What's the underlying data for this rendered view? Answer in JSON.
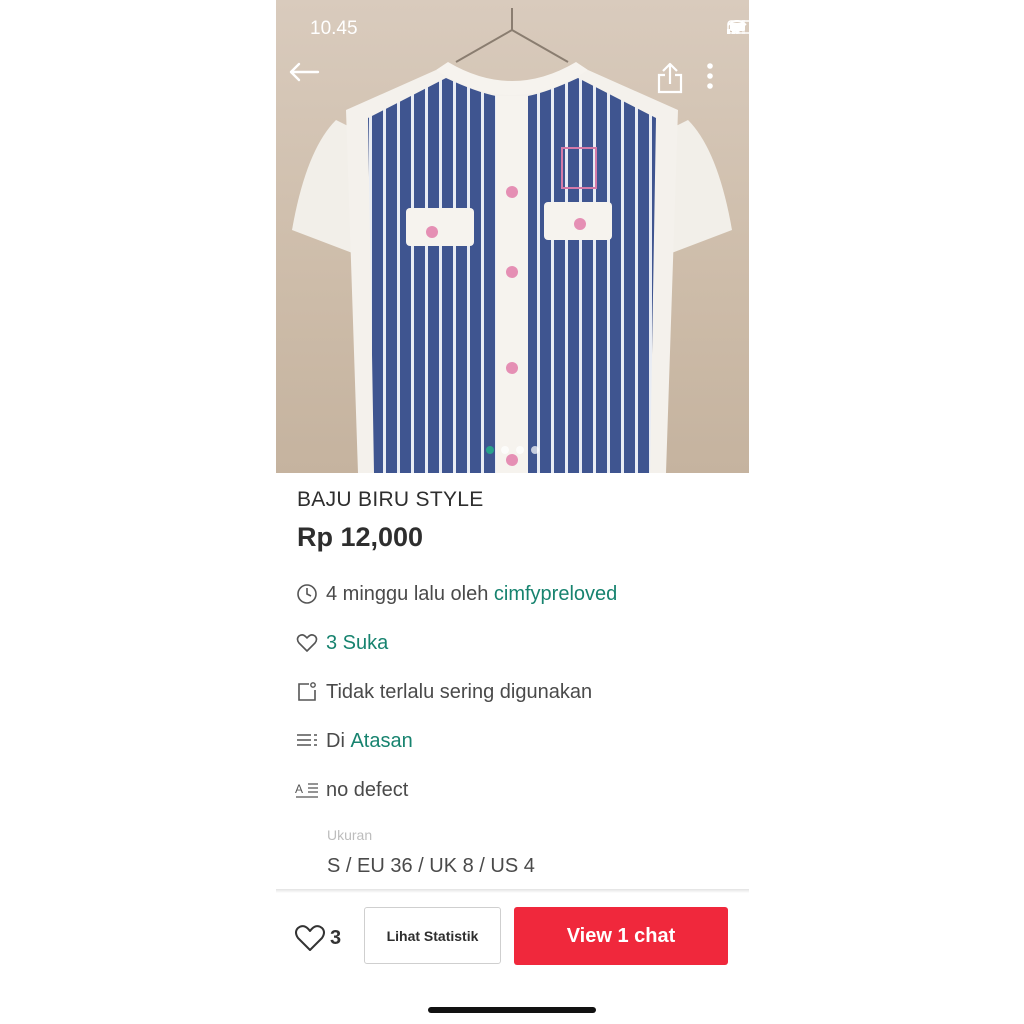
{
  "status_bar": {
    "time": "10.45"
  },
  "product": {
    "title": "BAJU BIRU STYLE",
    "price": "Rp 12,000",
    "image_pages": {
      "count": 4,
      "active_index": 0
    }
  },
  "details": {
    "posted_prefix": "4 minggu lalu oleh ",
    "seller": "cimfypreloved",
    "likes": "3 Suka",
    "condition": "Tidak terlalu sering digunakan",
    "category_prefix": "Di ",
    "category": "Atasan",
    "description": "no defect",
    "size_label": "Ukuran",
    "size_value": "S / EU 36 / UK 8 / US 4"
  },
  "bottom_bar": {
    "like_count": "3",
    "stats_button": "Lihat Statistik",
    "chat_button": "View 1 chat"
  },
  "colors": {
    "accent_green": "#17836f",
    "chat_red": "#f0283c",
    "shirt_blue": "#3f5590"
  },
  "icons": [
    "back-arrow-icon",
    "share-icon",
    "more-vertical-icon",
    "clock-icon",
    "heart-icon",
    "condition-icon",
    "category-icon",
    "description-icon"
  ]
}
